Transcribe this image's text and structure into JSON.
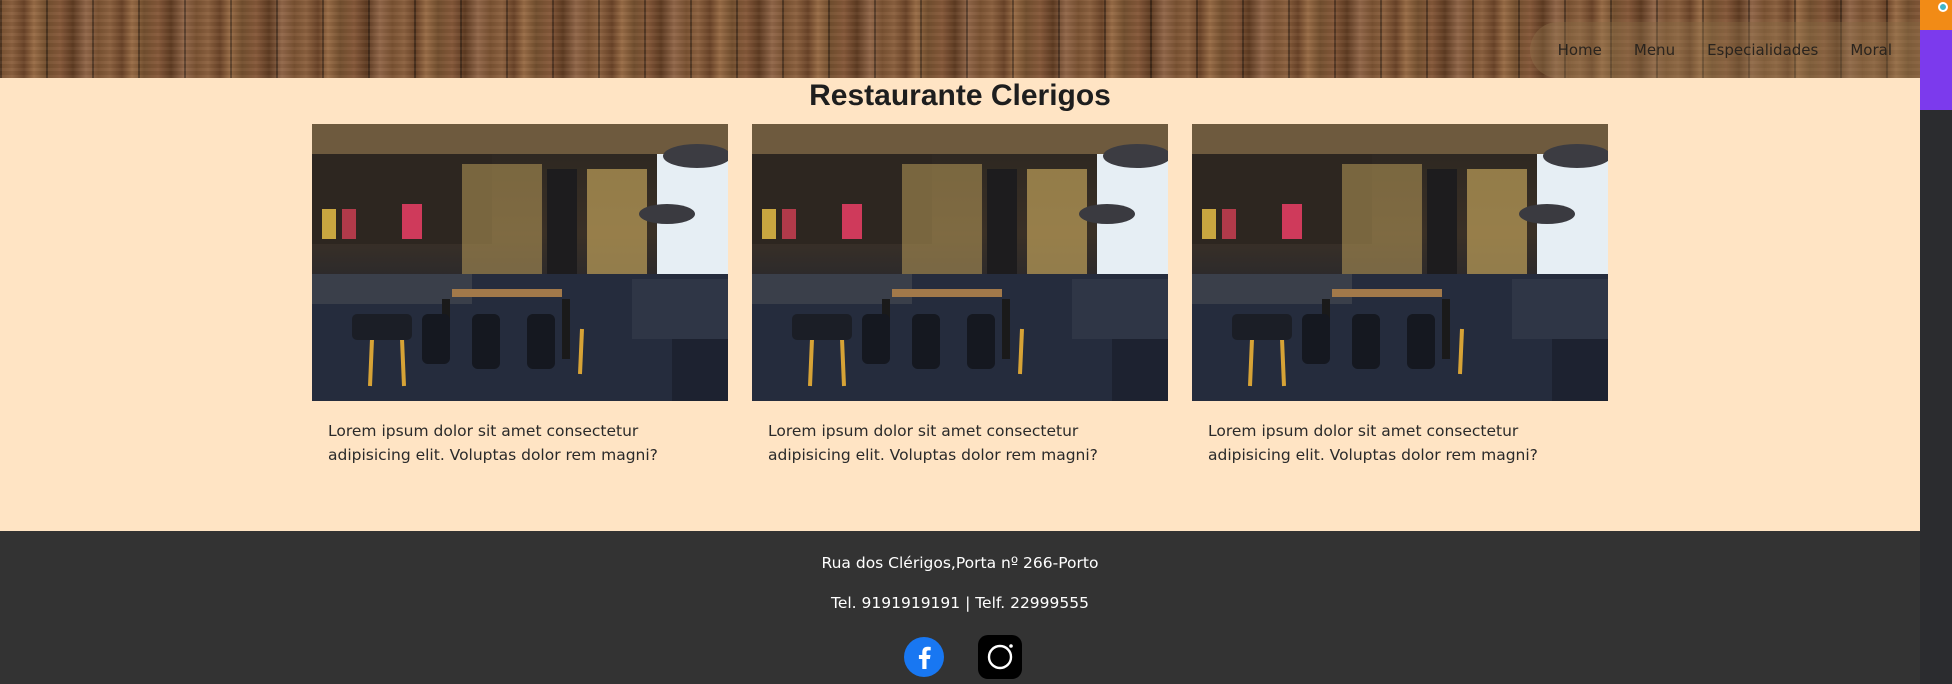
{
  "nav": {
    "items": [
      "Home",
      "Menu",
      "Especialidades",
      "Moral"
    ]
  },
  "main": {
    "title": "Restaurante Clerigos",
    "cards": [
      {
        "text": "Lorem ipsum dolor sit amet consectetur adipisicing elit. Voluptas dolor rem magni?",
        "image": "restaurant-interior-photo"
      },
      {
        "text": "Lorem ipsum dolor sit amet consectetur adipisicing elit. Voluptas dolor rem magni?",
        "image": "restaurant-interior-photo"
      },
      {
        "text": "Lorem ipsum dolor sit amet consectetur adipisicing elit. Voluptas dolor rem magni?",
        "image": "restaurant-interior-photo"
      }
    ]
  },
  "footer": {
    "address": "Rua dos Clérigos,Porta nº 266-Porto",
    "phones": "Tel. 9191919191 | Telf. 22999555",
    "social": [
      "facebook-icon",
      "instagram-icon"
    ]
  },
  "colors": {
    "page_background": "#ffe4c4",
    "footer_background": "#333333",
    "facebook_blue": "#1877f2"
  }
}
